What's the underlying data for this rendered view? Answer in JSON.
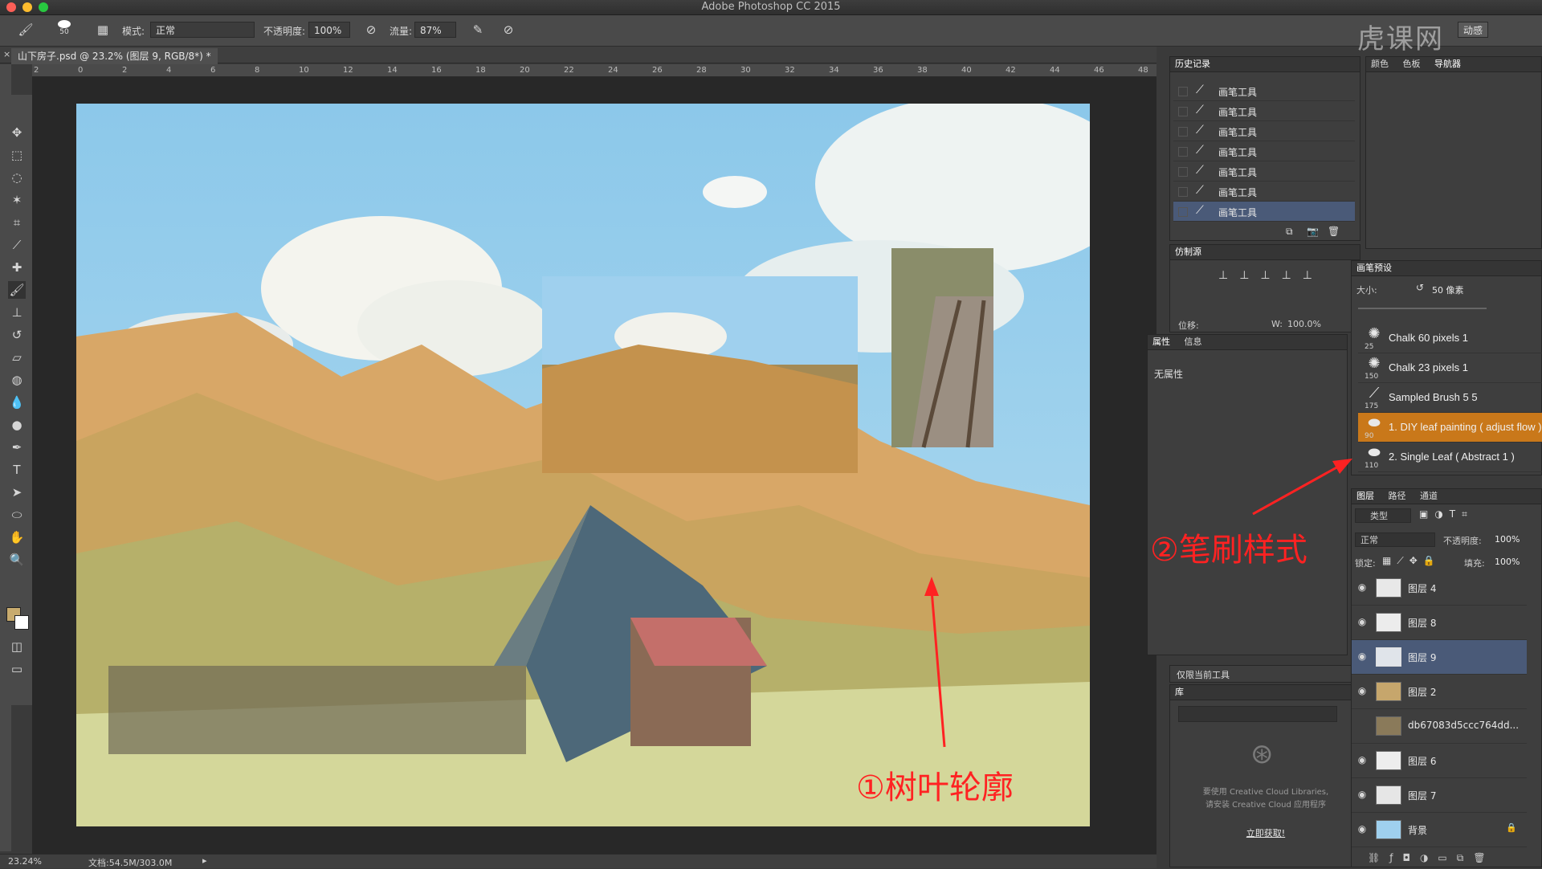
{
  "app": {
    "title": "Adobe Photoshop CC 2015"
  },
  "options_bar": {
    "brush_size": "50",
    "mode_label": "模式:",
    "mode_value": "正常",
    "opacity_label": "不透明度:",
    "opacity_value": "100%",
    "flow_label": "流量:",
    "flow_value": "87%",
    "workspace_label": "动感"
  },
  "document": {
    "tab_label": "山下房子.psd @ 23.2% (图层 9, RGB/8*) *",
    "ruler_ticks": [
      "2",
      "0",
      "2",
      "4",
      "6",
      "8",
      "10",
      "12",
      "14",
      "16",
      "18",
      "20",
      "22",
      "24",
      "26",
      "28",
      "30",
      "32",
      "34",
      "36",
      "38",
      "40",
      "42",
      "44",
      "46",
      "48"
    ]
  },
  "status_bar": {
    "zoom": "23.24%",
    "doc_size": "文档:54.5M/303.0M"
  },
  "history_panel": {
    "title": "历史记录",
    "items": [
      "画笔工具",
      "画笔工具",
      "画笔工具",
      "画笔工具",
      "画笔工具",
      "画笔工具",
      "画笔工具"
    ]
  },
  "color_tabs": [
    "颜色",
    "色板",
    "导航器"
  ],
  "clone_source_panel": {
    "title": "仿制源",
    "offset_label": "位移:",
    "w_label": "W:",
    "w_value": "100.0%"
  },
  "properties_panel": {
    "tabs": [
      "属性",
      "信息"
    ],
    "empty_text": "无属性"
  },
  "brush_presets": {
    "title": "画笔预设",
    "size_label": "大小:",
    "size_value": "50 像素",
    "items": [
      {
        "size": "25",
        "name": "Chalk 60 pixels 1",
        "selected": false
      },
      {
        "size": "150",
        "name": "Chalk 23 pixels 1",
        "selected": false
      },
      {
        "size": "175",
        "name": "Sampled Brush 5 5",
        "selected": false
      },
      {
        "size": "90",
        "name": "1.  DIY leaf painting ( adjust flow )",
        "selected": true
      },
      {
        "size": "110",
        "name": "2.  Single Leaf ( Abstract 1 )",
        "selected": false
      }
    ]
  },
  "tool_presets": {
    "label": "仅限当前工具"
  },
  "library": {
    "title": "库",
    "message_line1": "要使用 Creative Cloud Libraries,",
    "message_line2": "请安装 Creative Cloud 应用程序",
    "cta": "立即获取!"
  },
  "layers_panel": {
    "tabs": [
      "图层",
      "路径",
      "通道"
    ],
    "filter_label": "类型",
    "blend_mode": "正常",
    "opacity_label": "不透明度:",
    "opacity_value": "100%",
    "lock_label": "锁定:",
    "fill_label": "填充:",
    "fill_value": "100%",
    "layers": [
      {
        "name": "图层 4",
        "visible": true,
        "selected": false
      },
      {
        "name": "图层 8",
        "visible": true,
        "selected": false
      },
      {
        "name": "图层 9",
        "visible": true,
        "selected": true
      },
      {
        "name": "图层 2",
        "visible": true,
        "selected": false
      },
      {
        "name": "db67083d5ccc764dd...",
        "visible": false,
        "selected": false
      },
      {
        "name": "图层 6",
        "visible": true,
        "selected": false
      },
      {
        "name": "图层 7",
        "visible": true,
        "selected": false
      },
      {
        "name": "背景",
        "visible": true,
        "selected": false
      }
    ]
  },
  "annotations": {
    "leaf_outline": "①树叶轮廓",
    "brush_style": "②笔刷样式"
  },
  "watermark": "虎课网",
  "colors": {
    "accent_selected_brush": "#c9781a",
    "annotation_red": "#ff2222",
    "layer_selected": "#4a5a78"
  }
}
